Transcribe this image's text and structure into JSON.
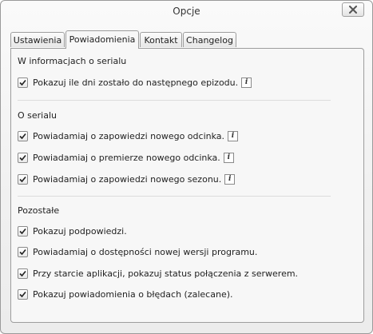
{
  "window": {
    "title": "Opcje"
  },
  "tabs": [
    {
      "label": "Ustawienia"
    },
    {
      "label": "Powiadomienia"
    },
    {
      "label": "Kontakt"
    },
    {
      "label": "Changelog"
    }
  ],
  "active_tab": "Powiadomienia",
  "sections": [
    {
      "title": "W informacjach o serialu",
      "options": [
        {
          "label": "Pokazuj ile dni zostało do następnego epizodu.",
          "checked": true,
          "has_info": true
        }
      ]
    },
    {
      "title": "O serialu",
      "options": [
        {
          "label": "Powiadamiaj o zapowiedzi nowego odcinka.",
          "checked": true,
          "has_info": true
        },
        {
          "label": "Powiadamiaj o premierze nowego odcinka.",
          "checked": true,
          "has_info": true
        },
        {
          "label": "Powiadamiaj o zapowiedzi nowego sezonu.",
          "checked": true,
          "has_info": true
        }
      ]
    },
    {
      "title": "Pozostałe",
      "options": [
        {
          "label": "Pokazuj podpowiedzi.",
          "checked": true,
          "has_info": false
        },
        {
          "label": "Powiadamiaj o dostępności nowej wersji programu.",
          "checked": true,
          "has_info": false
        },
        {
          "label": "Przy starcie aplikacji, pokazuj status połączenia z serwerem.",
          "checked": true,
          "has_info": false
        },
        {
          "label": "Pokazuj powiadomienia o błędach (zalecane).",
          "checked": true,
          "has_info": false
        }
      ]
    }
  ],
  "icons": {
    "close": "close-icon",
    "info": "info-icon",
    "check": "checkmark-icon"
  },
  "info_glyph": "i"
}
